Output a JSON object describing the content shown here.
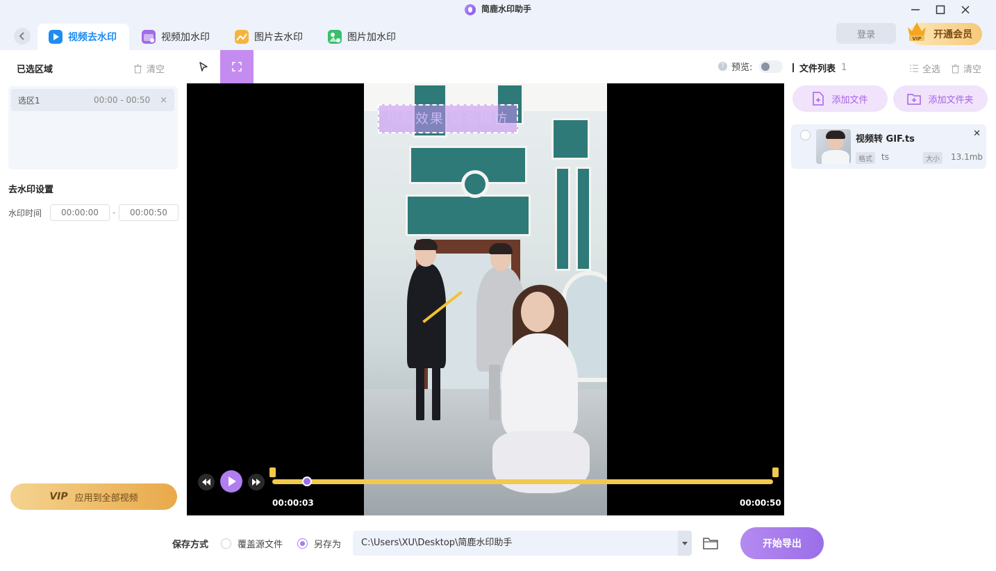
{
  "app": {
    "title": "简鹿水印助手"
  },
  "window": {
    "minimize_icon": "minimize-icon",
    "maximize_icon": "maximize-icon",
    "close_icon": "close-icon"
  },
  "tabs": [
    {
      "label": "视频去水印",
      "active": true,
      "icon": "video-remove-icon",
      "color": "#1f8cf0"
    },
    {
      "label": "视频加水印",
      "active": false,
      "icon": "video-add-icon",
      "color": "#a26be8"
    },
    {
      "label": "图片去水印",
      "active": false,
      "icon": "image-remove-icon",
      "color": "#f5b53c"
    },
    {
      "label": "图片加水印",
      "active": false,
      "icon": "image-add-icon",
      "color": "#36c06a"
    }
  ],
  "header": {
    "login_label": "登录",
    "vip_label": "开通会员",
    "vip_badge": "VIP"
  },
  "left": {
    "selected_title": "已选区域",
    "clear_label": "清空",
    "regions": [
      {
        "name": "选区1",
        "time": "00:00 - 00:50"
      }
    ],
    "settings_title": "去水印设置",
    "time_label": "水印时间",
    "time_start_placeholder": "00:00:00",
    "time_separator": "-",
    "time_end_placeholder": "00:00:50",
    "apply_vip": "VIP",
    "apply_label": "应用到全部视频"
  },
  "toolbar": {
    "preview_label": "预览:",
    "preview_on": false
  },
  "video": {
    "watermark_text": "视频效果 请勿模仿",
    "current_time": "00:00:03",
    "end_time": "00:00:50",
    "progress": 0.07
  },
  "right": {
    "title": "文件列表",
    "count": "1",
    "select_all": "全选",
    "clear": "清空",
    "add_file": "添加文件",
    "add_folder": "添加文件夹",
    "files": [
      {
        "name": "视频转 GIF.ts",
        "format_tag": "格式",
        "format": "ts",
        "size_tag": "大小",
        "size": "13.1mb"
      }
    ]
  },
  "bottom": {
    "save_label": "保存方式",
    "option_overwrite": "覆盖源文件",
    "option_save_as": "另存为",
    "selected": "save_as",
    "path": "C:\\Users\\XU\\Desktop\\简鹿水印助手",
    "export_label": "开始导出"
  },
  "colors": {
    "accent": "#a67ef0",
    "active_tab": "#1f8cf0",
    "timeline": "#f2c94c",
    "vip_gold": "#f6c97a"
  }
}
